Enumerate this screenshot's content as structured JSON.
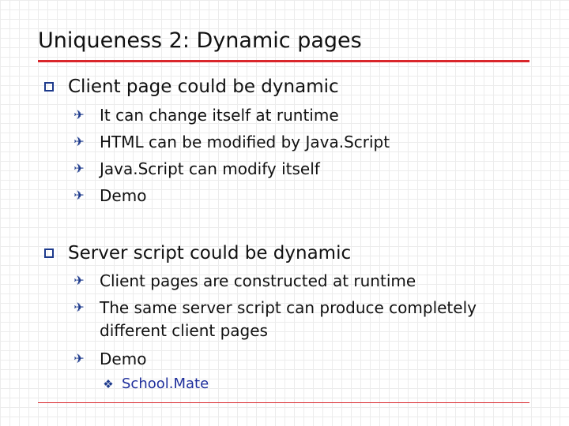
{
  "slide": {
    "title": "Uniqueness 2: Dynamic pages",
    "sections": [
      {
        "heading": "Client page could be dynamic",
        "items": [
          "It can change itself at runtime",
          "HTML can be modified by Java.Script",
          "Java.Script can modify itself",
          "Demo"
        ]
      },
      {
        "heading": "Server script could be dynamic",
        "items": [
          "Client pages are constructed at runtime",
          "The same server script can produce completely",
          "different client pages",
          "Demo"
        ],
        "subitem": "School.Mate"
      }
    ]
  },
  "icons": {
    "level1_bullet": "square-outline-icon",
    "level2_bullet": "airplane-icon",
    "level3_bullet": "diamond-icon"
  },
  "colors": {
    "title_rule": "#d9262b",
    "bullet": "#1d3a8c",
    "link": "#1f2f9c"
  }
}
